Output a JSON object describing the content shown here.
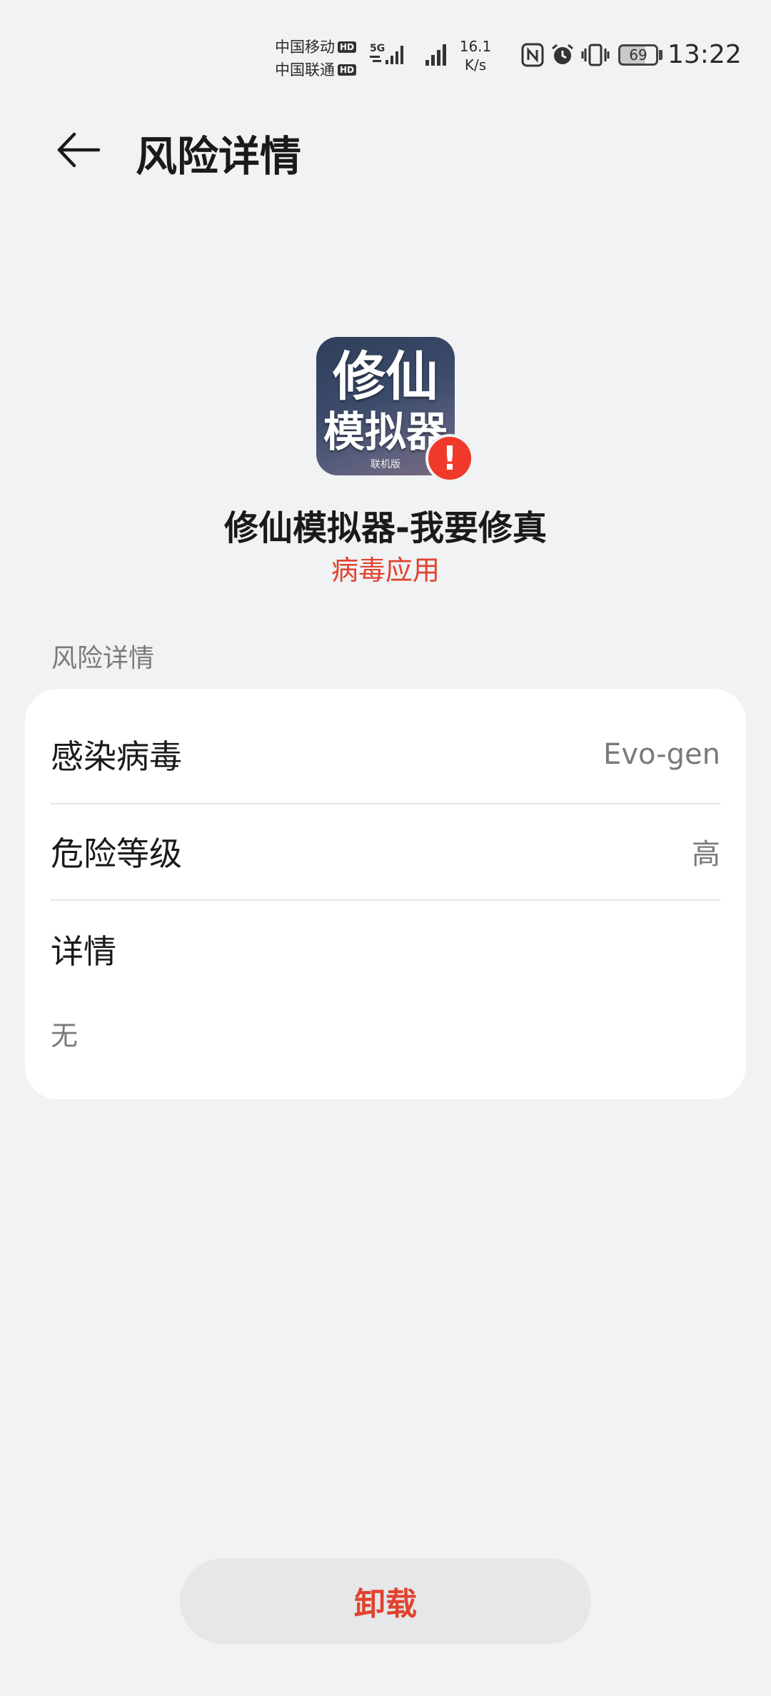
{
  "status_bar": {
    "carrier_1": "中国移动",
    "carrier_2": "中国联通",
    "hd_label": "HD",
    "network_type": "5G",
    "net_speed_value": "16.1",
    "net_speed_unit": "K/s",
    "battery_level": "69",
    "time": "13:22",
    "icons": [
      "nfc-icon",
      "alarm-icon",
      "vibrate-icon",
      "battery-icon"
    ]
  },
  "header": {
    "title": "风险详情",
    "back_icon": "back-arrow-icon"
  },
  "app": {
    "name": "修仙模拟器-我要修真",
    "status": "病毒应用",
    "status_color": "#e0432f",
    "icon_text_line1": "修仙",
    "icon_text_line2": "模拟器",
    "icon_text_line3": "联机版",
    "badge_symbol": "!"
  },
  "section": {
    "title": "风险详情",
    "rows": [
      {
        "label": "感染病毒",
        "value": "Evo-gen"
      },
      {
        "label": "危险等级",
        "value": "高"
      }
    ],
    "details_label": "详情",
    "details_value": "无"
  },
  "actions": {
    "uninstall_label": "卸载"
  }
}
